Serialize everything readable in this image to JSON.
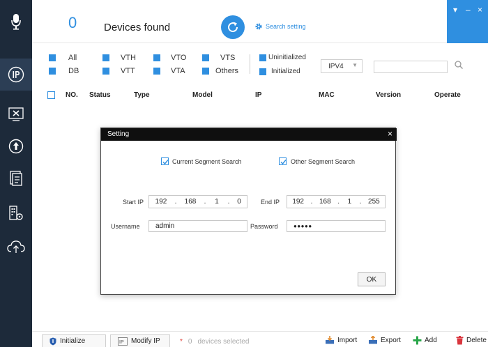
{
  "header": {
    "device_count": "0",
    "found_label": "Devices found",
    "search_setting_label": "Search setting",
    "window_controls": [
      "▾",
      "–",
      "×"
    ]
  },
  "sidebar": {
    "items": [
      {
        "icon": "mic-icon"
      },
      {
        "icon": "ip-icon",
        "active": true
      },
      {
        "icon": "tools-icon"
      },
      {
        "icon": "upgrade-icon"
      },
      {
        "icon": "document-icon"
      },
      {
        "icon": "building-settings-icon"
      },
      {
        "icon": "cloud-upload-icon"
      }
    ]
  },
  "filters": {
    "row1": [
      "All",
      "VTH",
      "VTO",
      "VTS"
    ],
    "row2": [
      "DB",
      "VTT",
      "VTA",
      "Others"
    ],
    "status": [
      "Uninitialized",
      "Initialized"
    ],
    "ip_version": "IPV4",
    "search_value": ""
  },
  "table": {
    "columns": [
      "NO.",
      "Status",
      "Type",
      "Model",
      "IP",
      "MAC",
      "Version",
      "Operate"
    ],
    "rows": []
  },
  "dialog": {
    "title": "Setting",
    "close": "×",
    "current_segment_label": "Current Segment Search",
    "other_segment_label": "Other Segment Search",
    "start_ip_label": "Start IP",
    "start_ip": [
      "192",
      "168",
      "1",
      "0"
    ],
    "end_ip_label": "End IP",
    "end_ip": [
      "192",
      "168",
      "1",
      "255"
    ],
    "username_label": "Username",
    "username": "admin",
    "password_label": "Password",
    "password_mask": "●●●●●",
    "ok_label": "OK",
    "current_segment_checked": true,
    "other_segment_checked": true
  },
  "bottom": {
    "initialize_label": "Initialize",
    "modify_ip_label": "Modify IP",
    "selected_star": "*",
    "selected_count": "0",
    "selected_label": "devices selected",
    "import_label": "Import",
    "export_label": "Export",
    "add_label": "Add",
    "delete_label": "Delete"
  },
  "colors": {
    "accent": "#2f8fe0",
    "sidebar_bg": "#1d2a3a",
    "dialog_title_bg": "#0f0f0f"
  }
}
